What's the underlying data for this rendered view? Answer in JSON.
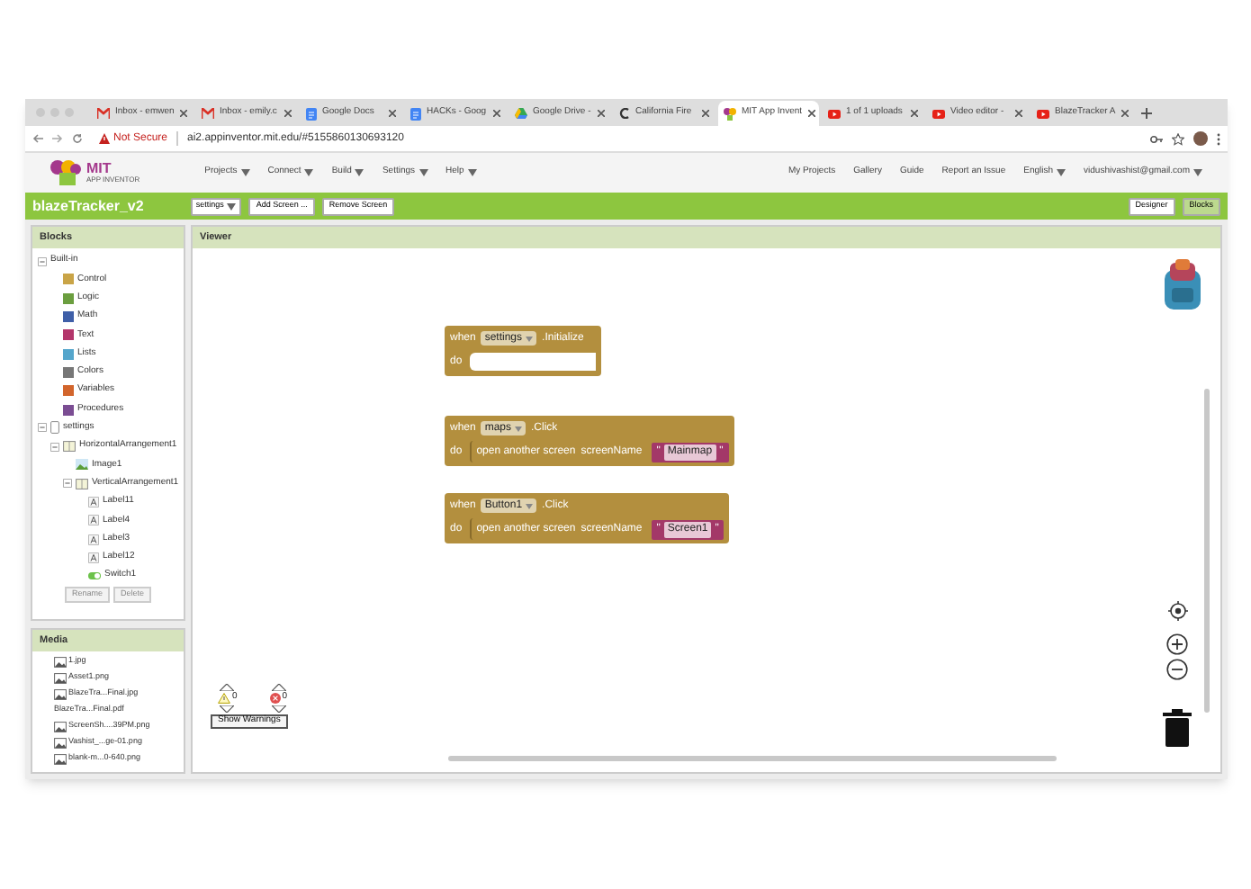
{
  "browser": {
    "tabs": [
      {
        "title": "Inbox - emwen",
        "kind": "mail",
        "selected": false
      },
      {
        "title": "Inbox - emily.c",
        "kind": "mail",
        "selected": false
      },
      {
        "title": "Google Docs",
        "kind": "docs",
        "selected": false
      },
      {
        "title": "HACKs - Goog",
        "kind": "docs",
        "selected": false
      },
      {
        "title": "Google Drive -",
        "kind": "drive",
        "selected": false
      },
      {
        "title": "California Fire",
        "kind": "generic",
        "selected": false
      },
      {
        "title": "MIT App Invent",
        "kind": "app",
        "selected": true
      },
      {
        "title": "1 of 1 uploads",
        "kind": "video",
        "selected": false
      },
      {
        "title": "Video editor -",
        "kind": "video",
        "selected": false
      },
      {
        "title": "BlazeTracker A",
        "kind": "video",
        "selected": false
      }
    ],
    "security": "Not Secure",
    "url": "ai2.appinventor.mit.edu/#5155860130693120"
  },
  "app": {
    "logo_top": "MIT",
    "logo_bottom": "APP INVENTOR",
    "menus": [
      "Projects",
      "Connect",
      "Build",
      "Settings",
      "Help"
    ],
    "links": [
      {
        "label": "My Projects",
        "dropdown": false
      },
      {
        "label": "Gallery",
        "dropdown": false
      },
      {
        "label": "Guide",
        "dropdown": false
      },
      {
        "label": "Report an Issue",
        "dropdown": false
      },
      {
        "label": "English",
        "dropdown": true
      },
      {
        "label": "vidushivashist@gmail.com",
        "dropdown": true
      }
    ]
  },
  "project": {
    "title": "blazeTracker_v2",
    "screen": "settings",
    "buttons": [
      "Add Screen ...",
      "Remove Screen"
    ],
    "modes": [
      {
        "label": "Designer",
        "selected": false
      },
      {
        "label": "Blocks",
        "selected": true
      }
    ]
  },
  "blocks_panel": {
    "title": "Blocks",
    "tree": [
      {
        "label": "Built-in",
        "kind": "folder",
        "expanded": true,
        "children": [
          {
            "label": "Control",
            "kind": "category",
            "color": "#c9a447"
          },
          {
            "label": "Logic",
            "kind": "category",
            "color": "#6b9e3f"
          },
          {
            "label": "Math",
            "kind": "category",
            "color": "#3f5fa8"
          },
          {
            "label": "Text",
            "kind": "category",
            "color": "#b3366b"
          },
          {
            "label": "Lists",
            "kind": "category",
            "color": "#55a6cc"
          },
          {
            "label": "Colors",
            "kind": "category",
            "color": "#777777"
          },
          {
            "label": "Variables",
            "kind": "category",
            "color": "#d2652c"
          },
          {
            "label": "Procedures",
            "kind": "category",
            "color": "#7b4d93"
          }
        ]
      },
      {
        "label": "settings",
        "kind": "screen",
        "expanded": true,
        "children": [
          {
            "label": "HorizontalArrangement1",
            "kind": "arrangement",
            "expanded": true,
            "children": [
              {
                "label": "Image1",
                "kind": "image"
              },
              {
                "label": "VerticalArrangement1",
                "kind": "arrangement",
                "expanded": true,
                "children": [
                  {
                    "label": "Label11",
                    "kind": "label"
                  },
                  {
                    "label": "Label4",
                    "kind": "label"
                  },
                  {
                    "label": "Label3",
                    "kind": "label"
                  },
                  {
                    "label": "Label12",
                    "kind": "label"
                  },
                  {
                    "label": "Switch1",
                    "kind": "switch"
                  }
                ]
              }
            ]
          }
        ]
      }
    ],
    "buttons": [
      "Rename",
      "Delete"
    ]
  },
  "media": {
    "title": "Media",
    "items": [
      {
        "name": "1.jpg",
        "kind": "image"
      },
      {
        "name": "Asset1.png",
        "kind": "image"
      },
      {
        "name": "BlazeTra...Final.jpg",
        "kind": "image"
      },
      {
        "name": "BlazeTra...Final.pdf",
        "kind": "file"
      },
      {
        "name": "ScreenSh....39PM.png",
        "kind": "image"
      },
      {
        "name": "Vashist_...ge-01.png",
        "kind": "image"
      },
      {
        "name": "blank-m...0-640.png",
        "kind": "image"
      }
    ]
  },
  "viewer": {
    "title": "Viewer",
    "blocks": [
      {
        "when": "when",
        "component": "settings",
        "event": ".Initialize",
        "do": "do"
      },
      {
        "when": "when",
        "component": "maps",
        "event": ".Click",
        "do": "do",
        "statement": {
          "text": "open another screen",
          "param": "screenName",
          "quote": "\"",
          "value": "Mainmap"
        }
      },
      {
        "when": "when",
        "component": "Button1",
        "event": ".Click",
        "do": "do",
        "statement": {
          "text": "open another screen",
          "param": "screenName",
          "quote": "\"",
          "value": "Screen1"
        }
      }
    ],
    "warnings": {
      "warning_count": "0",
      "error_count": "0",
      "button": "Show Warnings"
    }
  }
}
